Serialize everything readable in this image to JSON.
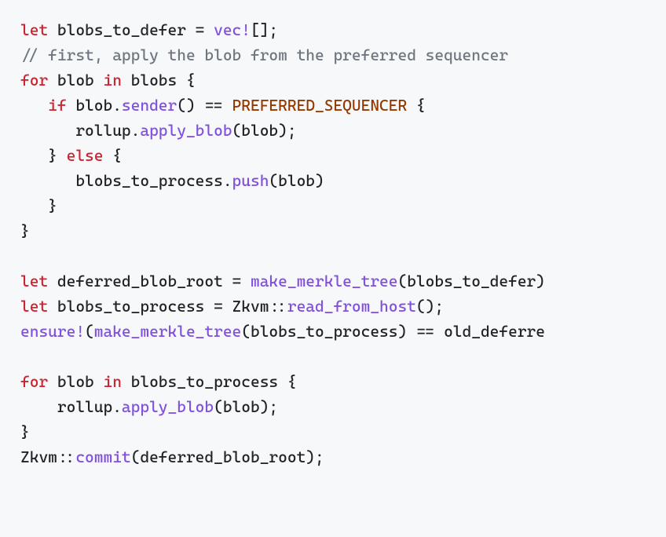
{
  "code": {
    "lines": {
      "l0": {
        "kw_let": "let",
        "id_blobs_to_defer": " blobs_to_defer = ",
        "macro_vec": "vec!",
        "bracket_empty": "[];"
      },
      "l1": {
        "comment": "// first, apply the blob from the preferred sequencer"
      },
      "l2": {
        "kw_for": "for",
        "txt_blob": " blob ",
        "kw_in": "in",
        "txt_blobs": " blobs {"
      },
      "l3": {
        "indent": "   ",
        "kw_if": "if",
        "txt_blob_dot": " blob.",
        "fn_sender": "sender",
        "txt_eq": "() == ",
        "const_pref": "PREFERRED_SEQUENCER",
        "txt_brace": " {"
      },
      "l4": {
        "indent": "      ",
        "txt_rollup": "rollup.",
        "fn_apply": "apply_blob",
        "txt_blob_arg": "(blob);"
      },
      "l5": {
        "indent": "   } ",
        "kw_else": "else",
        "txt_brace": " {"
      },
      "l6": {
        "indent": "      ",
        "txt_btp": "blobs_to_process.",
        "fn_push": "push",
        "txt_blob_arg": "(blob)"
      },
      "l7": {
        "txt_close": "   }"
      },
      "l8": {
        "txt_close": "}"
      },
      "l9": {
        "blank": " "
      },
      "l10": {
        "kw_let": "let",
        "txt_dbr": " deferred_blob_root = ",
        "fn_mmt": "make_merkle_tree",
        "txt_arg": "(blobs_to_defer)"
      },
      "l11": {
        "kw_let": "let",
        "txt_btp": " blobs_to_process = Zkvm::",
        "fn_read": "read_from_host",
        "txt_paren": "();"
      },
      "l12": {
        "macro_ensure": "ensure!",
        "txt_open": "(",
        "fn_mmt": "make_merkle_tree",
        "txt_rest": "(blobs_to_process) == old_deferre"
      },
      "l13": {
        "blank": " "
      },
      "l14": {
        "kw_for": "for",
        "txt_blob": " blob ",
        "kw_in": "in",
        "txt_btp": " blobs_to_process {"
      },
      "l15": {
        "indent": "    ",
        "txt_rollup": "rollup.",
        "fn_apply": "apply_blob",
        "txt_blob_arg": "(blob);"
      },
      "l16": {
        "txt_close": "}"
      },
      "l17": {
        "txt_zkvm": "Zkvm::",
        "fn_commit": "commit",
        "txt_arg": "(deferred_blob_root);"
      }
    }
  }
}
